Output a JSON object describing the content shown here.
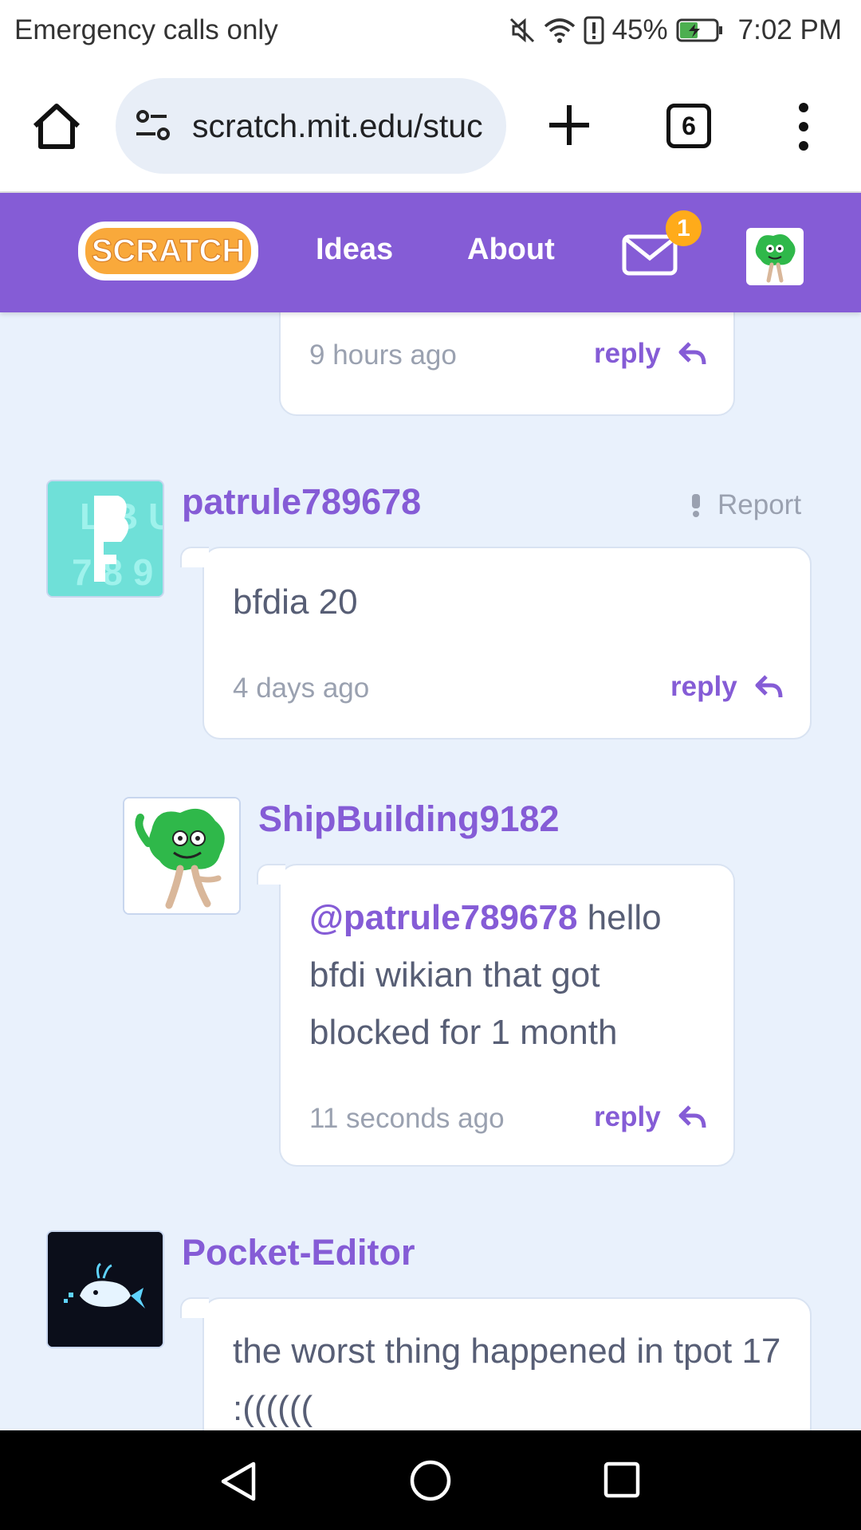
{
  "status_bar": {
    "carrier": "Emergency calls only",
    "battery": "45%",
    "time": "7:02 PM"
  },
  "browser": {
    "url": "scratch.mit.edu/stuc",
    "tab_count": "6"
  },
  "scratch_nav": {
    "logo_text": "SCRATCH",
    "ideas": "Ideas",
    "about": "About",
    "message_count": "1"
  },
  "comments": [
    {
      "time": "9 hours ago",
      "reply": "reply"
    },
    {
      "username": "patrule789678",
      "report": "Report",
      "text": "bfdia 20",
      "time": "4 days ago",
      "reply": "reply"
    },
    {
      "username": "ShipBuilding9182",
      "mention": "@patrule789678",
      "text": " hello bfdi wikian that got blocked for 1 month",
      "time": "11 seconds ago",
      "reply": "reply"
    },
    {
      "username": "Pocket-Editor",
      "text": "the worst thing happened in tpot 17 :(((((("
    }
  ]
}
